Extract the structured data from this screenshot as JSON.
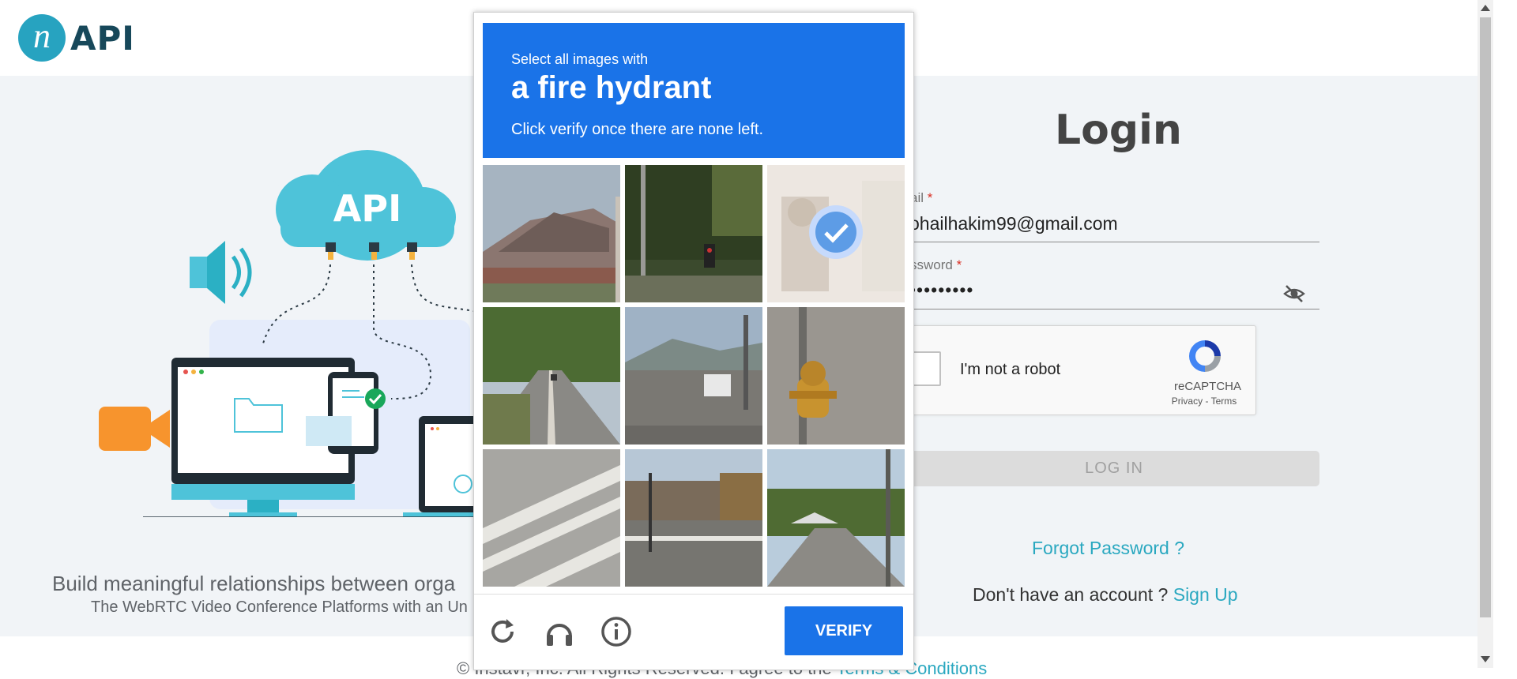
{
  "brand": {
    "logo_letter": "n",
    "logo_text": "API"
  },
  "illustration": {
    "cloud_label": "API"
  },
  "tagline": {
    "line1": "Build meaningful relationships between orga",
    "line2": "The WebRTC Video Conference Platforms with an Un"
  },
  "login": {
    "title": "Login",
    "email_label": "ail",
    "email_value": "ohailhakim99@gmail.com",
    "password_label": "ssword",
    "password_value": "•••••••••",
    "required_mark": "*",
    "recaptcha": {
      "label": "I'm not a robot",
      "brand": "reCAPTCHA",
      "privacy": "Privacy",
      "separator": " - ",
      "terms": "Terms"
    },
    "login_button": "LOG IN",
    "forgot_link": "Forgot Password ?",
    "signup_prompt": "Don't have an account ?",
    "signup_link": "Sign Up"
  },
  "footer": {
    "text": "© Instavr, Inc. All Rights Reserved. I agree to the",
    "link": "Terms & Conditions"
  },
  "captcha": {
    "instruction_line1": "Select all images with",
    "target": "a fire hydrant",
    "instruction_line2": "Click verify once there are none left.",
    "verify_button": "VERIFY",
    "tiles": [
      {
        "subject": "house roof",
        "selected": false
      },
      {
        "subject": "traffic signal",
        "selected": false
      },
      {
        "subject": "fire hydrant",
        "selected": true
      },
      {
        "subject": "road with trees",
        "selected": false
      },
      {
        "subject": "intersection",
        "selected": false
      },
      {
        "subject": "fire hydrant",
        "selected": false
      },
      {
        "subject": "crosswalk",
        "selected": false
      },
      {
        "subject": "street corner",
        "selected": false
      },
      {
        "subject": "road",
        "selected": false
      }
    ],
    "icons": [
      "reload-icon",
      "audio-icon",
      "info-icon"
    ]
  },
  "colors": {
    "captcha_blue": "#1a73e8",
    "accent": "#2aa8c0",
    "page_bg": "#f1f4f7"
  }
}
